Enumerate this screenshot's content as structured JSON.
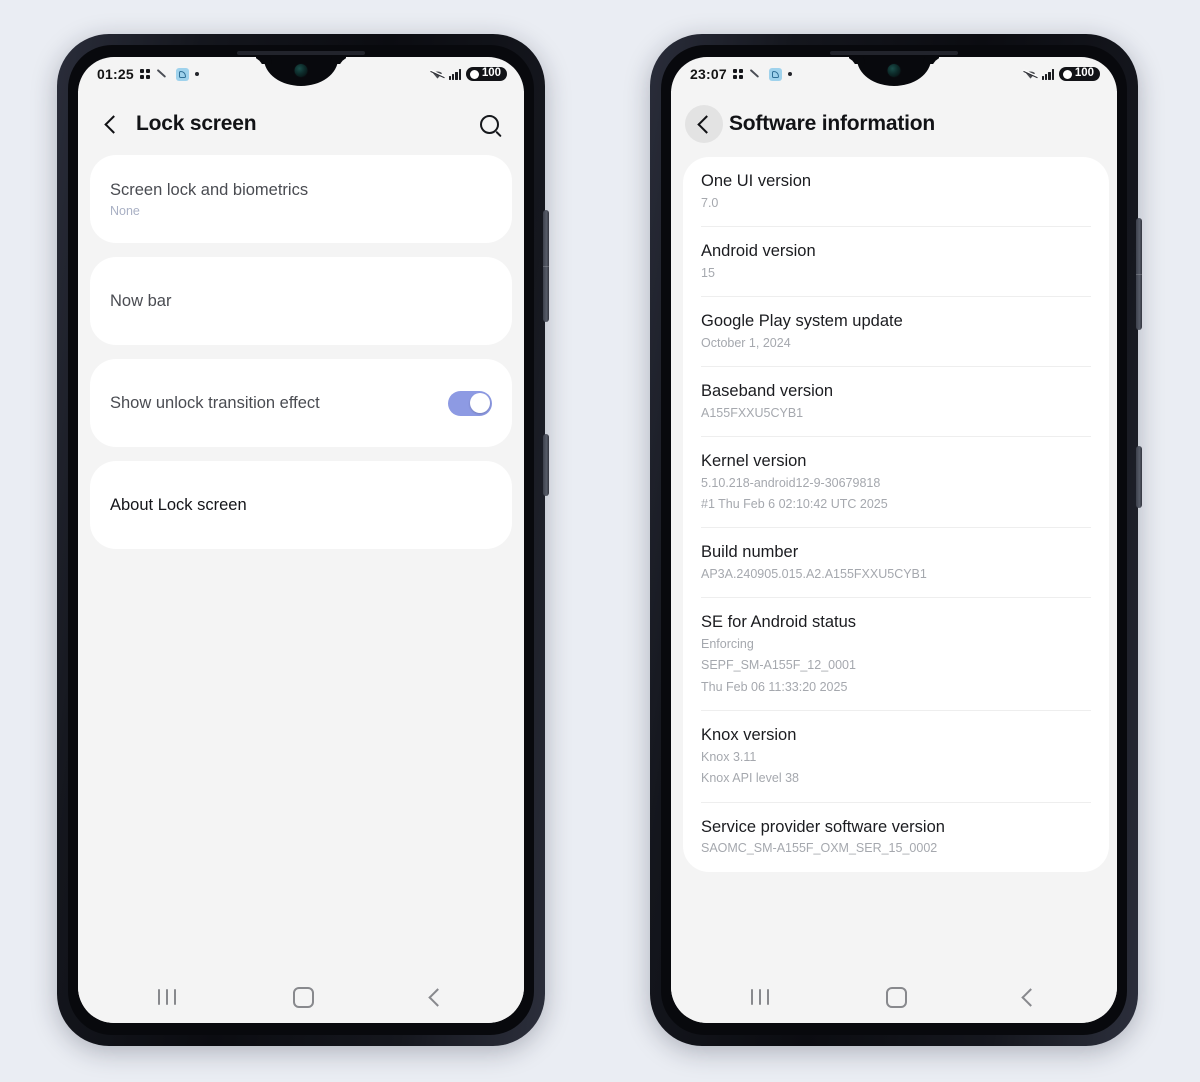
{
  "background_color": "#eaedf3",
  "phones": [
    {
      "id": "lock-screen-phone",
      "status_bar": {
        "time": "01:25",
        "battery_level": "100",
        "icons": [
          "dots-grid-icon",
          "pen-icon",
          "share-icon",
          "dot-icon",
          "wifi-icon",
          "signal-icon",
          "battery-icon"
        ]
      },
      "appbar": {
        "back_label": "back-icon",
        "title": "Lock screen",
        "search_label": "search-icon",
        "back_pressed": false
      },
      "cards": [
        {
          "rows": [
            {
              "title": "Screen lock and biometrics",
              "sub": "None",
              "style": "dim",
              "control": "none"
            }
          ]
        },
        {
          "rows": [
            {
              "title": "Now bar",
              "sub": "",
              "style": "dim",
              "control": "none"
            }
          ]
        },
        {
          "rows": [
            {
              "title": "Show unlock transition effect",
              "sub": "",
              "style": "dim",
              "control": "toggle",
              "toggle_on": true
            }
          ]
        },
        {
          "rows": [
            {
              "title": "About Lock screen",
              "sub": "",
              "style": "strong",
              "control": "none"
            }
          ]
        }
      ],
      "navbar": {
        "recents": "recents-icon",
        "home": "home-icon",
        "back": "back-icon"
      }
    },
    {
      "id": "software-information-phone",
      "status_bar": {
        "time": "23:07",
        "battery_level": "100",
        "icons": [
          "dots-grid-icon",
          "pen-icon",
          "share-icon",
          "dot-icon",
          "wifi-icon",
          "signal-icon",
          "battery-icon"
        ]
      },
      "appbar": {
        "back_label": "back-icon",
        "title": "Software information",
        "search_label": "",
        "back_pressed": true
      },
      "info_rows": [
        {
          "title": "One UI version",
          "values": [
            "7.0"
          ]
        },
        {
          "title": "Android version",
          "values": [
            "15"
          ]
        },
        {
          "title": "Google Play system update",
          "values": [
            "October 1, 2024"
          ]
        },
        {
          "title": "Baseband version",
          "values": [
            "A155FXXU5CYB1"
          ]
        },
        {
          "title": "Kernel version",
          "values": [
            "5.10.218-android12-9-30679818",
            "#1 Thu Feb 6 02:10:42 UTC 2025"
          ]
        },
        {
          "title": "Build number",
          "values": [
            "AP3A.240905.015.A2.A155FXXU5CYB1"
          ]
        },
        {
          "title": "SE for Android status",
          "values": [
            "Enforcing",
            "SEPF_SM-A155F_12_0001",
            "Thu Feb 06 11:33:20 2025"
          ]
        },
        {
          "title": "Knox version",
          "values": [
            "Knox 3.11",
            "Knox API level 38"
          ]
        },
        {
          "title": "Service provider software version",
          "values": [
            "SAOMC_SM-A155F_OXM_SER_15_0002"
          ]
        }
      ],
      "navbar": {
        "recents": "recents-icon",
        "home": "home-icon",
        "back": "back-icon"
      }
    }
  ]
}
